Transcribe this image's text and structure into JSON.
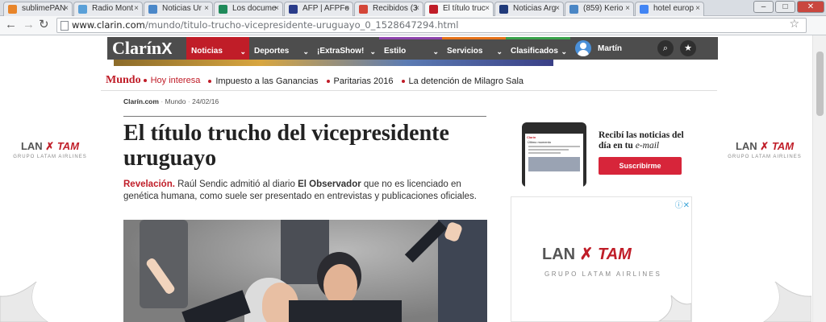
{
  "browser": {
    "tabs": [
      {
        "title": "sublimePAN",
        "color": "#e8852a",
        "active": false
      },
      {
        "title": "Radio Mont",
        "color": "#5aa0d8",
        "active": false
      },
      {
        "title": "Noticias Ur",
        "color": "#4b88c9",
        "active": false
      },
      {
        "title": "Los docume",
        "color": "#1f8a5a",
        "active": false
      },
      {
        "title": "AFP | AFPFo",
        "color": "#2a3c8a",
        "active": false
      },
      {
        "title": "Recibidos (3",
        "color": "#d44638",
        "active": false
      },
      {
        "title": "El título truc",
        "color": "#c01d28",
        "active": true
      },
      {
        "title": "Noticias Arg",
        "color": "#203a7a",
        "active": false
      },
      {
        "title": "(859) Kerio",
        "color": "#4a86c5",
        "active": false
      },
      {
        "title": "hotel europ",
        "color": "#4285f4",
        "active": false
      }
    ],
    "url_domain": "www.clarin.com",
    "url_path": "/mundo/titulo-trucho-vicepresidente-uruguayo_0_1528647294.html",
    "window_controls": {
      "minimize": "–",
      "maximize": "□",
      "close": "✕"
    }
  },
  "site": {
    "logo": "Clarín",
    "nav": [
      {
        "label": "Noticias",
        "accent": "#c01d28"
      },
      {
        "label": "Deportes",
        "accent": "#4d4d4d"
      },
      {
        "label": "¡ExtraShow!",
        "accent": "#4d4d4d"
      },
      {
        "label": "Estilo",
        "accent": "#8e44ad"
      },
      {
        "label": "Servicios",
        "accent": "#e6731a"
      },
      {
        "label": "Clasificados",
        "accent": "#3aa24a"
      }
    ],
    "user_name": "Martín",
    "section": "Mundo",
    "hoy": "Hoy interesa",
    "trending": [
      "Impuesto a las Ganancias",
      "Paritarias 2016",
      "La detención de Milagro Sala"
    ],
    "breadcrumb": {
      "site": "Clarín.com",
      "section": "Mundo",
      "date": "24/02/16"
    }
  },
  "article": {
    "headline": "El título trucho del vicepresidente uruguayo",
    "kicker": "Revelación.",
    "lead_a": "Raúl Sendic admitió al diario ",
    "lead_b": "El Observador",
    "lead_c": " que no es licenciado en genética humana, como suele ser presentado en entrevistas y publicaciones oficiales."
  },
  "newsletter": {
    "text": "Recibí las noticias del día en tu ",
    "text_em": "e-mail",
    "button": "Suscribirme",
    "phone_brand": "Clarín",
    "phone_header": "Último momento"
  },
  "ads": {
    "lan": "LAN",
    "tam": "TAM",
    "group": "GRUPO LATAM AIRLINES"
  },
  "colors": {
    "brand_red": "#c01d28",
    "nav_bg": "#4d4d4d",
    "button_red": "#d7253a"
  }
}
